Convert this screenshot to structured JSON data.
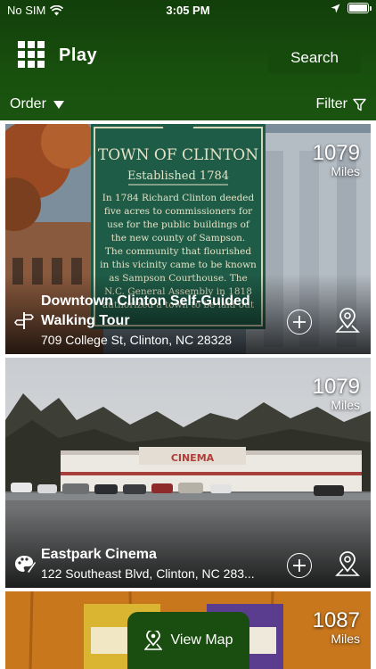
{
  "status": {
    "carrier": "No SIM",
    "time": "3:05 PM"
  },
  "header": {
    "title": "Play",
    "search_label": "Search",
    "order_label": "Order",
    "filter_label": "Filter"
  },
  "listings": [
    {
      "title_line1": "Downtown Clinton Self-Guided",
      "title_line2": "Walking Tour",
      "address": "709 College St, Clinton, NC 28328",
      "distance": "1079",
      "unit": "Miles",
      "category_icon": "signpost-icon",
      "image": {
        "sign_line1": "TOWN OF CLINTON",
        "sign_line2": "Established 1784",
        "sign_body": [
          "In 1784 Richard Clinton deeded",
          "five acres to commissioners for",
          "use for the public buildings of",
          "the new county of Sampson.",
          "The community that flourished",
          "in this vicinity came to be known",
          "as Sampson Courthouse. The",
          "N.C. General Assembly in 1818",
          "authorized a town to be laid out"
        ]
      }
    },
    {
      "title_line1": "Eastpark Cinema",
      "address": "122 Southeast Blvd, Clinton, NC 283...",
      "distance": "1079",
      "unit": "Miles",
      "category_icon": "palette-icon",
      "image": {
        "marquee": "CINEMA"
      }
    },
    {
      "distance": "1087",
      "unit": "Miles"
    }
  ],
  "view_map_label": "View Map",
  "colors": {
    "header_green": "#1b5410",
    "map_button_green": "#1a4d10"
  }
}
